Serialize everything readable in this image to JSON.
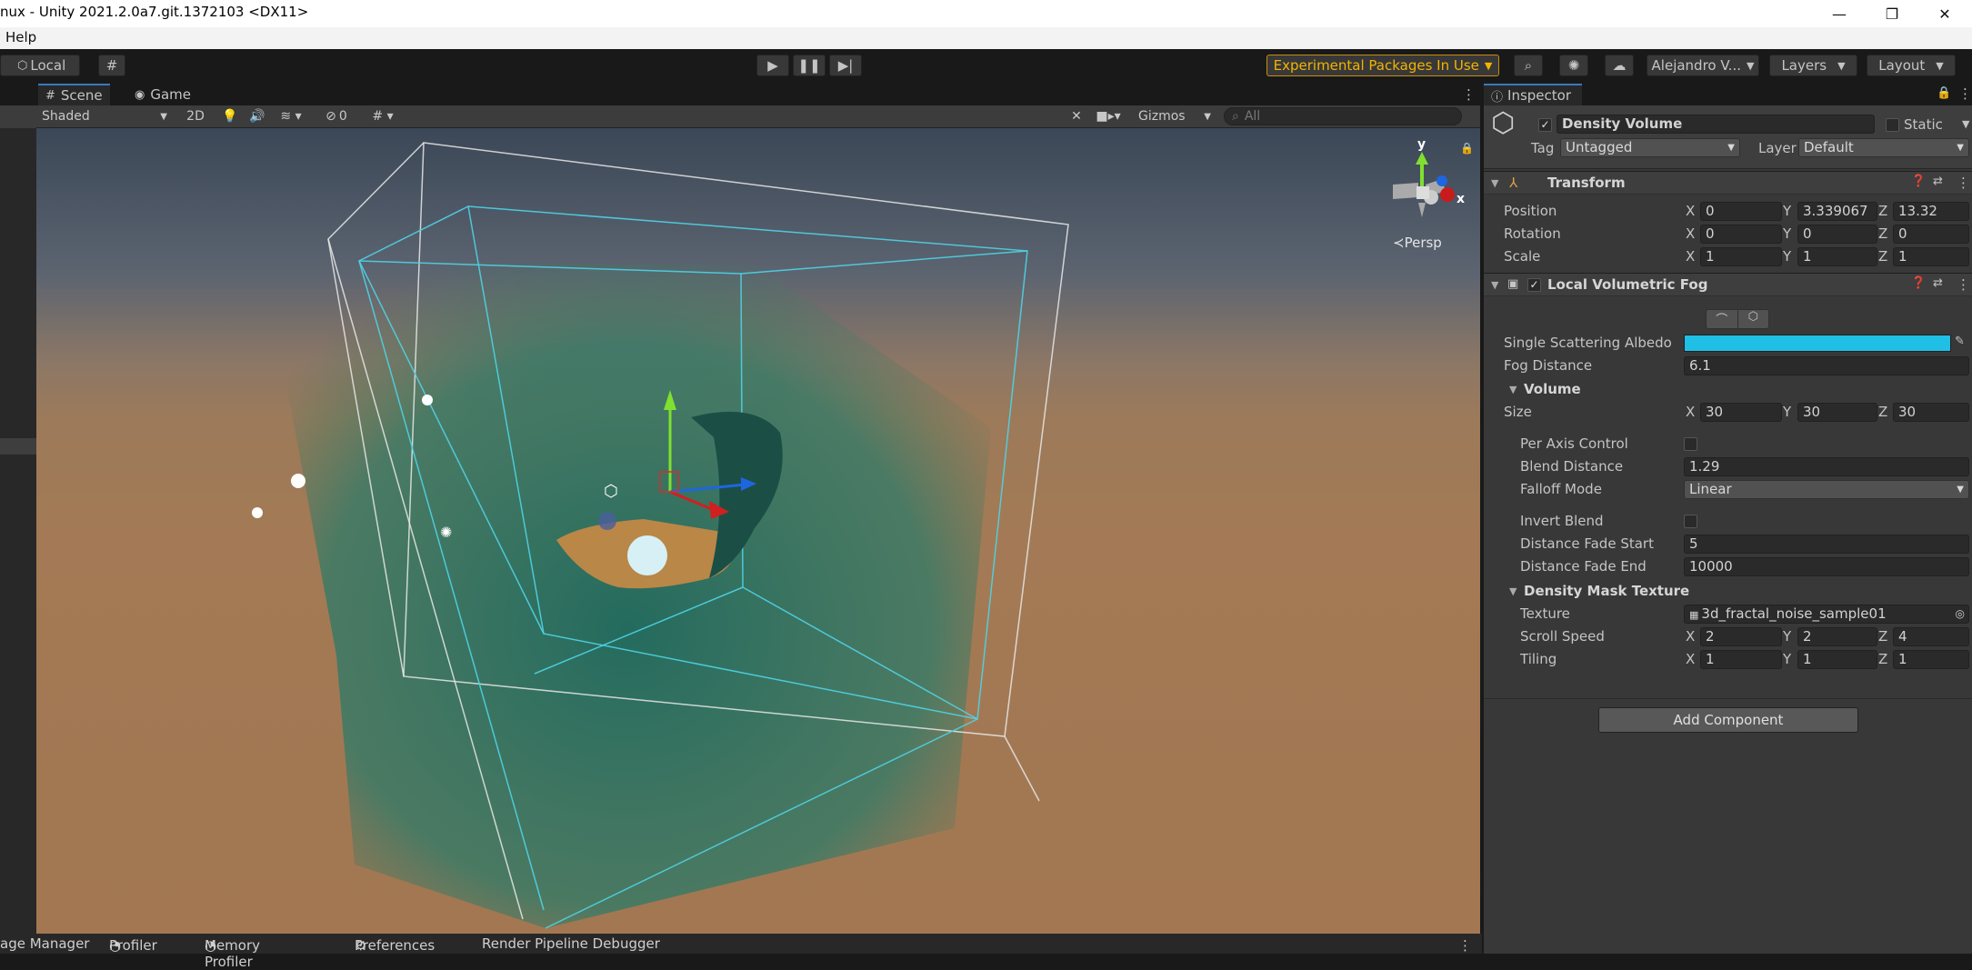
{
  "window": {
    "title": "nux - Unity 2021.2.0a7.git.1372103 <DX11>",
    "minimize": "—",
    "maximize": "❐",
    "close": "✕"
  },
  "menu": {
    "help": "Help"
  },
  "toolbar": {
    "local": "Local",
    "experimental": "Experimental Packages In Use",
    "account": "Alejandro V...",
    "layers": "Layers",
    "layout": "Layout"
  },
  "scene": {
    "tab_scene": "Scene",
    "tab_game": "Game",
    "shading": "Shaded",
    "mode_2d": "2D",
    "hidden_count": "0",
    "gizmos": "Gizmos",
    "search_placeholder": "All",
    "persp": "Persp",
    "axis_x": "x",
    "axis_y": "y"
  },
  "bottom": {
    "package_manager": "age Manager",
    "profiler": "Profiler",
    "memory_profiler": "Memory Profiler",
    "preferences": "Preferences",
    "render_debugger": "Render Pipeline Debugger"
  },
  "inspector": {
    "tab": "Inspector",
    "object_name": "Density Volume",
    "static": "Static",
    "tag_label": "Tag",
    "tag_value": "Untagged",
    "layer_label": "Layer",
    "layer_value": "Default",
    "transform": {
      "title": "Transform",
      "position": {
        "label": "Position",
        "x": "0",
        "y": "3.339067",
        "z": "13.32"
      },
      "rotation": {
        "label": "Rotation",
        "x": "0",
        "y": "0",
        "z": "0"
      },
      "scale": {
        "label": "Scale",
        "x": "1",
        "y": "1",
        "z": "1"
      }
    },
    "fog": {
      "title": "Local Volumetric Fog",
      "albedo_label": "Single Scattering Albedo",
      "albedo_color": "#1fbfe6",
      "fog_distance_label": "Fog Distance",
      "fog_distance": "6.1",
      "volume_title": "Volume",
      "size": {
        "label": "Size",
        "x": "30",
        "y": "30",
        "z": "30"
      },
      "per_axis_label": "Per Axis Control",
      "blend_distance_label": "Blend Distance",
      "blend_distance": "1.29",
      "falloff_label": "Falloff Mode",
      "falloff": "Linear",
      "invert_label": "Invert Blend",
      "fade_start_label": "Distance Fade Start",
      "fade_start": "5",
      "fade_end_label": "Distance Fade End",
      "fade_end": "10000",
      "mask_title": "Density Mask Texture",
      "texture_label": "Texture",
      "texture": "3d_fractal_noise_sample01",
      "scroll": {
        "label": "Scroll Speed",
        "x": "2",
        "y": "2",
        "z": "4"
      },
      "tiling": {
        "label": "Tiling",
        "x": "1",
        "y": "1",
        "z": "1"
      }
    },
    "add_component": "Add Component",
    "x": "X",
    "y": "Y",
    "z": "Z"
  }
}
